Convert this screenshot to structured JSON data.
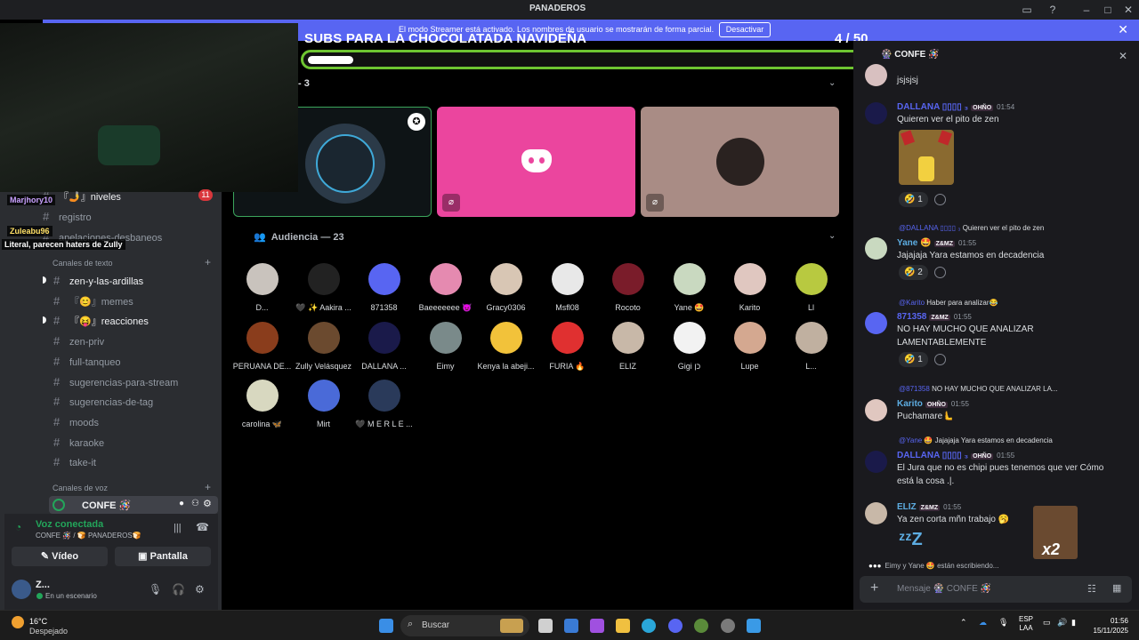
{
  "window": {
    "title": "PANADEROS",
    "title_icon": "bread-emoji"
  },
  "streamer_banner": {
    "message": "El modo Streamer está activado. Los nombres de usuario se mostrarán de forma parcial.",
    "button": "Desactivar",
    "color": "#5865f2"
  },
  "overlay": {
    "subs_title": "SUBS PARA LA CHOCOLATADA NAVIDEÑA",
    "subs_count": "4  / 50",
    "progress_fraction": 0.08,
    "bar_color": "#6ec531"
  },
  "sidebar": {
    "channels_top": [
      {
        "label": "『🤳』niveles",
        "badge": "11"
      },
      {
        "label": "registro"
      },
      {
        "label": "apelaciones-desbaneos"
      }
    ],
    "text_category": "Canales de texto",
    "text_channels": [
      {
        "label": "zen-y-las-ardillas",
        "unread": true
      },
      {
        "label": "『😊』memes"
      },
      {
        "label": "『😝』reacciones",
        "unread": true
      },
      {
        "label": "zen-priv"
      },
      {
        "label": "full-tanqueo"
      },
      {
        "label": "sugerencias-para-stream"
      },
      {
        "label": "sugerencias-de-tag"
      },
      {
        "label": "moods"
      },
      {
        "label": "karaoke"
      },
      {
        "label": "take-it"
      }
    ],
    "voice_category": "Canales de voz",
    "voice_channel": "CONFE 🪅"
  },
  "voice_panel": {
    "status": "Voz conectada",
    "location": "CONFE 🪅 / 🍞 PANADEROS🍞",
    "video_button": "Vídeo",
    "screen_button": "Pantalla"
  },
  "user_panel": {
    "name": "Z...",
    "status": "En un escenario"
  },
  "stream_chat_overlays": [
    {
      "user": "Marjhory10",
      "color": "#c9a0ff"
    },
    {
      "user": "Zuleabu96",
      "color": "#ffe066"
    },
    {
      "text": "Literal, parecen haters de Zully",
      "color": "#ffffff"
    }
  ],
  "stage": {
    "speakers_header": "- 3",
    "audience_header": "Audiencia — 23",
    "audience": [
      {
        "name": "D...",
        "color": "#c9c3bd"
      },
      {
        "name": "🖤 ✨ Aakira ...",
        "color": "#222222"
      },
      {
        "name": "871358",
        "color": "#5865f2"
      },
      {
        "name": "Baeeeeeee 👿",
        "color": "#e58ab0"
      },
      {
        "name": "Gracy0306",
        "color": "#d8c6b4"
      },
      {
        "name": "Msfl08",
        "color": "#e8e8e8"
      },
      {
        "name": "Rocoto",
        "color": "#7a1c2a"
      },
      {
        "name": "Yane 🤩",
        "color": "#c9d9c0"
      },
      {
        "name": "Karito",
        "color": "#e0c7c0"
      },
      {
        "name": "Ll",
        "color": "#b8c940"
      },
      {
        "name": "PERUANA DE...",
        "color": "#8a3d1c"
      },
      {
        "name": "Zully Velásquez",
        "color": "#6b4a2f"
      },
      {
        "name": "DALLANA ...",
        "color": "#1a1a4a"
      },
      {
        "name": "Eimy",
        "color": "#7a8a8a"
      },
      {
        "name": "Kenya la abeji...",
        "color": "#f2c23a"
      },
      {
        "name": "FURIA 🔥",
        "color": "#e03030"
      },
      {
        "name": "ELIZ",
        "color": "#c8b8a8"
      },
      {
        "name": "Gigi כן",
        "color": "#f2f2f2"
      },
      {
        "name": "Lupe",
        "color": "#d4a890"
      },
      {
        "name": "L...",
        "color": "#c0b0a0"
      },
      {
        "name": "carolina 🦋",
        "color": "#d8d8c0"
      },
      {
        "name": "Mirt",
        "color": "#4a6ad8"
      },
      {
        "name": "🖤 M E R L E ...",
        "color": "#2a3a5a"
      }
    ]
  },
  "chat": {
    "channel": "CONFE 🪅",
    "messages": [
      {
        "text": "jsjsjsj"
      },
      {
        "name": "DALLANA ▯▯▯▯ ₃",
        "tag": "OHÑO",
        "time": "01:54",
        "name_color": "#5865f2",
        "text": "Quieren ver el pito de zen",
        "reaction": "1"
      },
      {
        "reply": "@DALLANA ▯▯▯▯ ₃",
        "reply_text": "Quieren ver el pito de zen",
        "name": "Yane 🤩",
        "tag": "Z&MZ",
        "time": "01:55",
        "name_color": "#5dade2",
        "text": "Jajajaja Yara estamos en decadencia",
        "reaction": "2"
      },
      {
        "reply": "@Karito",
        "reply_text": "Haber para analizar😂",
        "name": "871358",
        "tag": "Z&MZ",
        "time": "01:55",
        "name_color": "#5865f2",
        "text": "NO HAY MUCHO QUE ANALIZAR",
        "text2": "LAMENTABLEMENTE",
        "reaction": "1"
      },
      {
        "reply": "@871358",
        "reply_text": "NO HAY MUCHO QUE ANALIZAR LA...",
        "name": "Karito",
        "tag": "OHÑO",
        "time": "01:55",
        "name_color": "#5dade2",
        "text": "Puchamare🫷"
      },
      {
        "reply": "@Yane 🤩",
        "reply_text": "Jajajaja Yara estamos en decadencia",
        "name": "DALLANA ▯▯▯▯ ₃",
        "tag": "OHÑO",
        "time": "01:55",
        "name_color": "#5865f2",
        "text": "El Jura que no es chipi pues tenemos que ver Cómo",
        "text2": "está la cosa .|."
      },
      {
        "name": "ELIZ",
        "tag": "Z&MZ",
        "time": "01:55",
        "name_color": "#5dade2",
        "text": "Ya zen corta mñn trabajo 🥱"
      }
    ],
    "typing": "Eimy y Yane 🤩 están escribiendo...",
    "composer_placeholder": "Mensaje 🎡 CONFE 🪅",
    "sticker_text": "x2"
  },
  "taskbar": {
    "weather_temp": "16°C",
    "weather_desc": "Despejado",
    "search_placeholder": "Buscar",
    "lang_top": "ESP",
    "lang_bottom": "LAA",
    "time": "01:56",
    "date": "15/11/2025"
  }
}
